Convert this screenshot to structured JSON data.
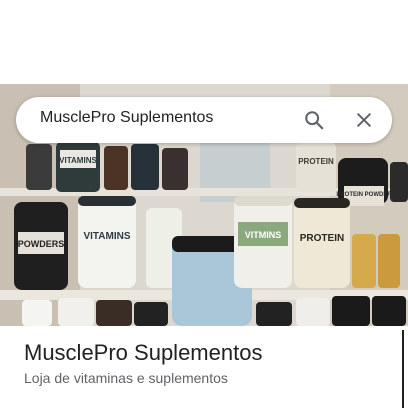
{
  "search": {
    "query": "MusclePro Suplementos",
    "search_icon": "search-icon",
    "close_icon": "close-icon"
  },
  "hero": {
    "image_subject": "supplement shelf photo",
    "labels": {
      "vitamins_top": "VITAMINS",
      "protein_top": "PROTEIN",
      "protein_powder": "PROTEIN POWDER",
      "powders": "POWDERS",
      "vitamins_big": "VITAMINS",
      "vitamins_green": "VITMINS",
      "protein_big": "PROTEIN"
    }
  },
  "place": {
    "title": "MusclePro Suplementos",
    "subtitle": "Loja de vitaminas e suplementos"
  },
  "colors": {
    "text_primary": "#202124",
    "text_secondary": "#5f6368"
  }
}
